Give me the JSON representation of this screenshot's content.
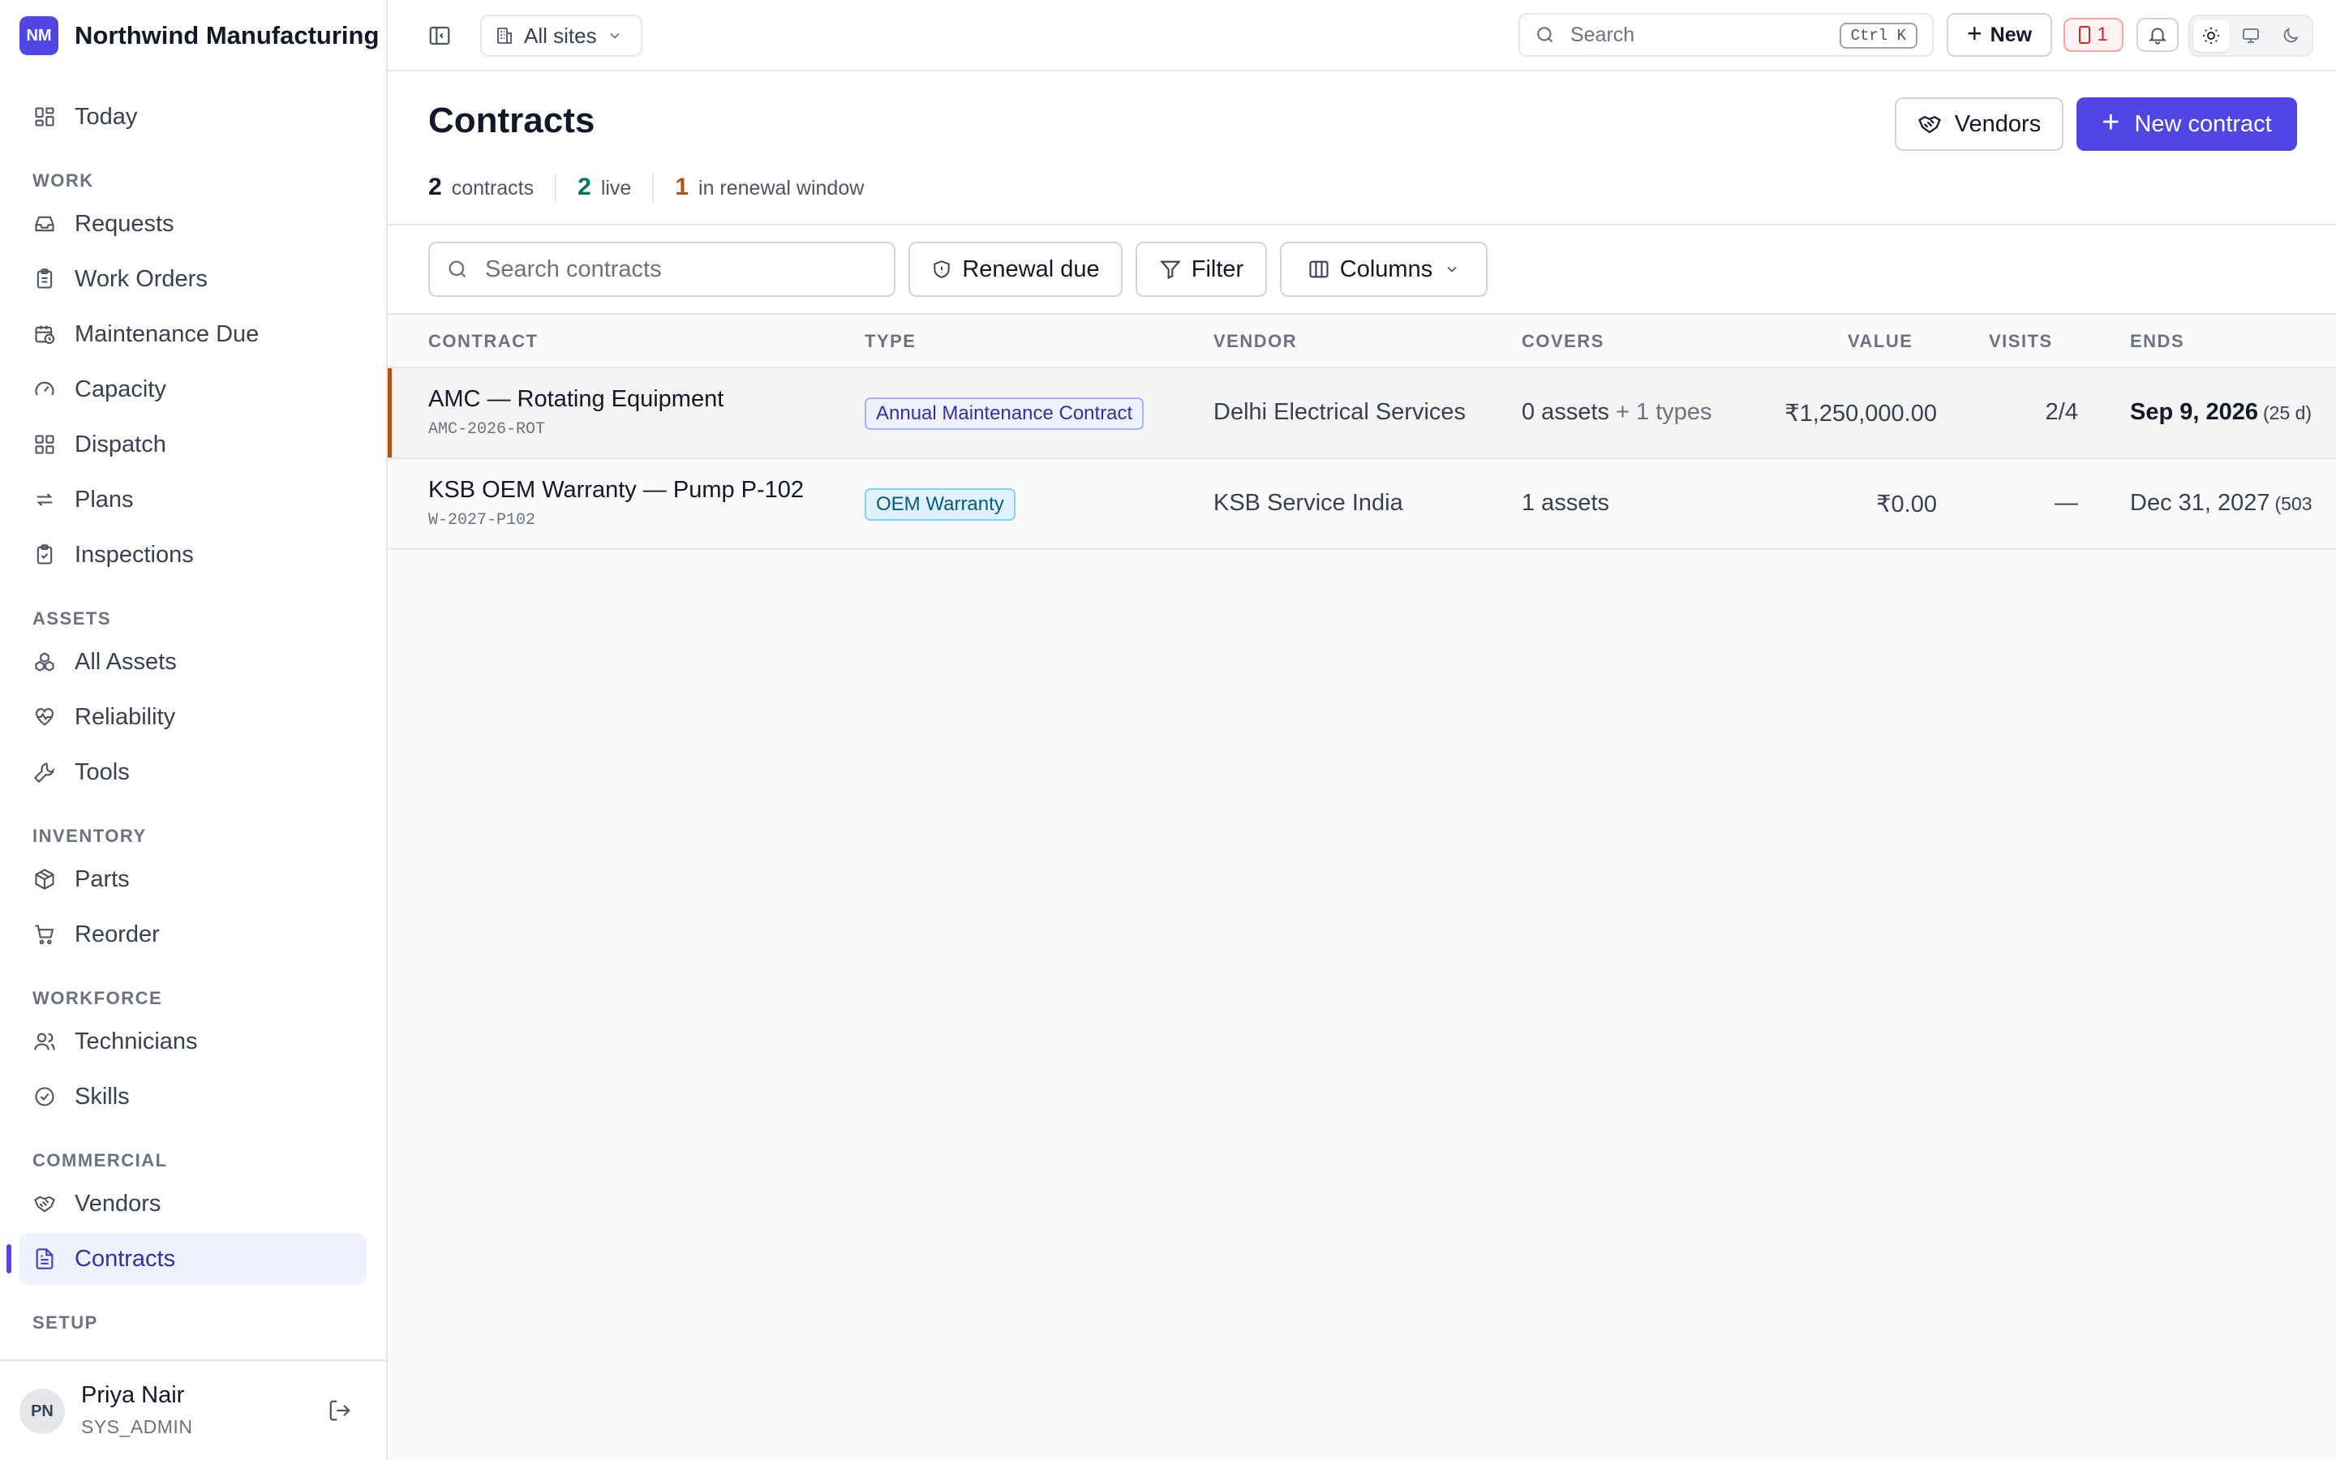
{
  "brand": {
    "initials": "NM",
    "name": "Northwind Manufacturing"
  },
  "sidebar": {
    "top_item": {
      "label": "Today"
    },
    "sections": [
      {
        "title": "WORK",
        "items": [
          {
            "label": "Requests"
          },
          {
            "label": "Work Orders"
          },
          {
            "label": "Maintenance Due"
          },
          {
            "label": "Capacity"
          },
          {
            "label": "Dispatch"
          },
          {
            "label": "Plans"
          },
          {
            "label": "Inspections"
          }
        ]
      },
      {
        "title": "ASSETS",
        "items": [
          {
            "label": "All Assets"
          },
          {
            "label": "Reliability"
          },
          {
            "label": "Tools"
          }
        ]
      },
      {
        "title": "INVENTORY",
        "items": [
          {
            "label": "Parts"
          },
          {
            "label": "Reorder"
          }
        ]
      },
      {
        "title": "WORKFORCE",
        "items": [
          {
            "label": "Technicians"
          },
          {
            "label": "Skills"
          }
        ]
      },
      {
        "title": "COMMERCIAL",
        "items": [
          {
            "label": "Vendors"
          },
          {
            "label": "Contracts",
            "active": true
          }
        ]
      },
      {
        "title": "SETUP",
        "items": []
      }
    ],
    "user": {
      "initials": "PN",
      "name": "Priya Nair",
      "role": "SYS_ADMIN"
    }
  },
  "topbar": {
    "site_selector": "All sites",
    "search_placeholder": "Search",
    "search_shortcut": "Ctrl K",
    "new_label": "New",
    "alert_count": "1"
  },
  "page": {
    "title": "Contracts",
    "stats": [
      {
        "value": "2",
        "label": "contracts",
        "color": "#111827"
      },
      {
        "value": "2",
        "label": "live",
        "color": "#047857"
      },
      {
        "value": "1",
        "label": "in renewal window",
        "color": "#b45309"
      }
    ],
    "vendors_button": "Vendors",
    "new_contract_button": "New contract"
  },
  "toolbar": {
    "search_placeholder": "Search contracts",
    "renewal_label": "Renewal due",
    "filter_label": "Filter",
    "columns_label": "Columns"
  },
  "table": {
    "headers": {
      "contract": "CONTRACT",
      "type": "TYPE",
      "vendor": "VENDOR",
      "covers": "COVERS",
      "value": "VALUE",
      "visits": "VISITS",
      "ends": "ENDS"
    },
    "rows": [
      {
        "name": "AMC — Rotating Equipment",
        "code": "AMC-2026-ROT",
        "type": "Annual Maintenance Contract",
        "vendor": "Delhi Electrical Services",
        "covers": "0 assets",
        "covers_extra": "+ 1 types",
        "value": "₹1,250,000.00",
        "visits": "2/4",
        "ends": "Sep 9, 2026",
        "ends_remaining": "(25 d)"
      },
      {
        "name": "KSB OEM Warranty — Pump P-102",
        "code": "W-2027-P102",
        "type": "OEM Warranty",
        "vendor": "KSB Service India",
        "covers": "1 assets",
        "covers_extra": "",
        "value": "₹0.00",
        "visits": "—",
        "ends": "Dec 31, 2027",
        "ends_remaining": "(503"
      }
    ]
  },
  "colors": {
    "accent": "#4f46e5",
    "warning": "#b45309",
    "success": "#047857",
    "danger": "#dc2626"
  }
}
